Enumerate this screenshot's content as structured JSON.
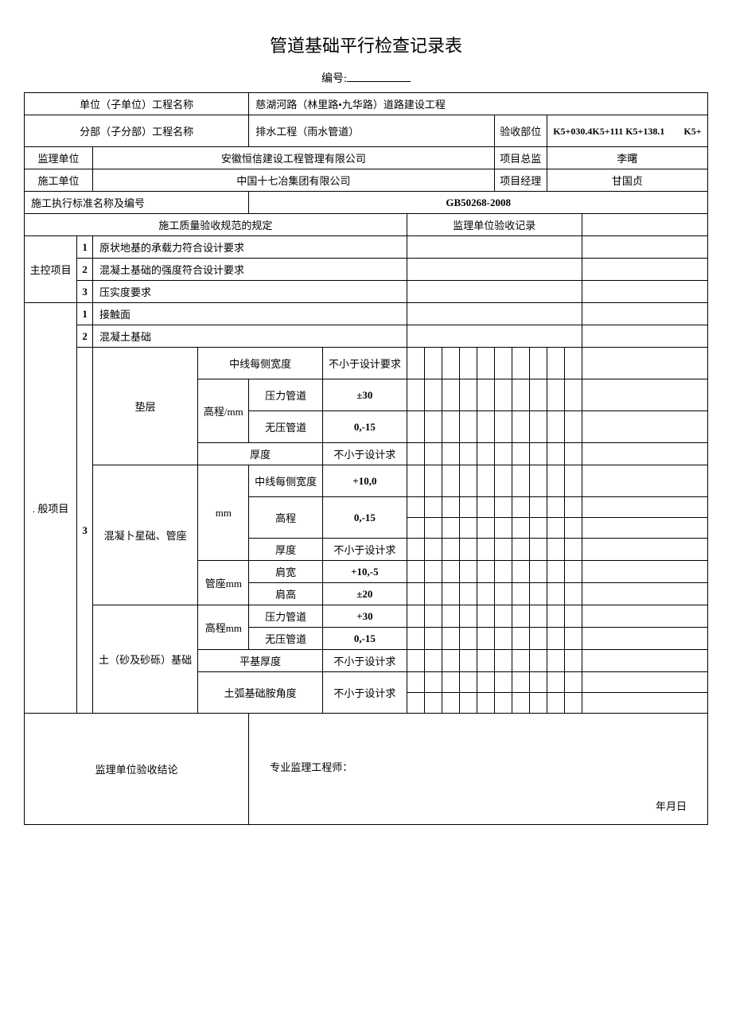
{
  "title": "管道基础平行检查记录表",
  "serial_label": "编号:",
  "header": {
    "unit_project_label": "单位（子单位）工程名称",
    "unit_project_value": "慈湖河路（林里路•九华路）道路建设工程",
    "sub_project_label": "分部（子分部）工程名称",
    "sub_project_value": "排水工程（雨水管道）",
    "accept_part_label": "验收部位",
    "accept_part_value": "K5+030.4K5+111 K5+138.1　　K5+",
    "supervisor_label": "监理单位",
    "supervisor_value": "安徽恒信建设工程管理有限公司",
    "pm_director_label": "项目总监",
    "pm_director_value": "李曙",
    "construction_label": "施工单位",
    "construction_value": "中国十七冶集团有限公司",
    "pm_manager_label": "项目经理",
    "pm_manager_value": "甘国贞",
    "standard_label": "施工执行标准名称及编号",
    "standard_value": "GB50268-2008",
    "quality_spec_label": "施工质量验收规范的规定",
    "supervisor_record_label": "监理单位验收记录"
  },
  "main_control": {
    "label": "主控项目",
    "items": [
      {
        "no": "1",
        "desc": "原状地基的承载力符合设计要求"
      },
      {
        "no": "2",
        "desc": "混凝土基础的强度符合设计要求"
      },
      {
        "no": "3",
        "desc": "压实度要求"
      }
    ]
  },
  "general": {
    "label": ". 般项目",
    "items_simple": [
      {
        "no": "1",
        "desc": "接触面"
      },
      {
        "no": "2",
        "desc": "混凝土基础"
      }
    ],
    "group_no": "3",
    "dianceng": {
      "label": "垫层",
      "centerline": "中线每侧宽度",
      "centerline_req": "不小于设计要求",
      "elevation": "高程/mm",
      "pressure_pipe": "压力管道",
      "pressure_val": "±30",
      "nopressure_pipe": "无压管道",
      "nopressure_val": "0,-15",
      "thickness": "厚度",
      "thickness_req": "不小于设计求"
    },
    "concrete": {
      "label": "混凝卜星础、管座",
      "mm": "mm",
      "centerline": "中线每侧宽度",
      "centerline_val": "+10,0",
      "elevation": "高程",
      "elevation_val": "0,-15",
      "thickness": "厚度",
      "thickness_req": "不小于设计求",
      "seat": "管座mm",
      "shoulder_w": "肩宽",
      "shoulder_w_val": "+10,-5",
      "shoulder_h": "肩高",
      "shoulder_h_val": "±20"
    },
    "soil": {
      "label": "土（砂及砂砾）基础",
      "elev_mm": "高程mm",
      "pressure_pipe": "压力管道",
      "pressure_val": "+30",
      "nopressure_pipe": "无压管道",
      "nopressure_val": "0,-15",
      "flat_thick": "平基厚度",
      "flat_thick_req": "不小于设计求",
      "arc_angle": "土弧基础胺角度",
      "arc_angle_req": "不小于设计求"
    }
  },
  "footer": {
    "conclusion_label": "监理单位验收结论",
    "engineer_label": "专业监理工程师：",
    "date_label": "年月日"
  }
}
